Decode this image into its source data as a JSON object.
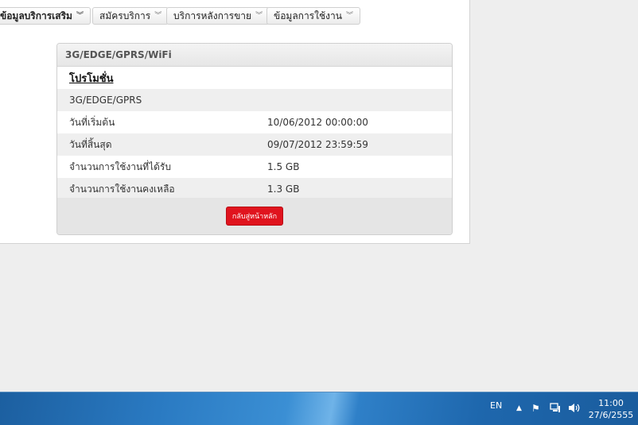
{
  "nav": {
    "items": [
      {
        "label": "ข้อมูลบริการเสริม"
      },
      {
        "label": "สมัครบริการ"
      },
      {
        "label": "บริการหลังการขาย"
      },
      {
        "label": "ข้อมูลการใช้งาน"
      }
    ]
  },
  "card": {
    "title": "3G/EDGE/GPRS/WiFi",
    "promo_label": "โปรโมชั่น",
    "package_name": "3G/EDGE/GPRS",
    "rows": [
      {
        "label": "วันที่เริ่มต้น",
        "value": "10/06/2012 00:00:00"
      },
      {
        "label": "วันที่สิ้นสุด",
        "value": "09/07/2012 23:59:59"
      },
      {
        "label": "จำนวนการใช้งานที่ได้รับ",
        "value": "1.5 GB"
      },
      {
        "label": "จำนวนการใช้งานคงเหลือ",
        "value": "1.3 GB"
      }
    ],
    "back_label": "กลับสู่หน้าหลัก"
  },
  "taskbar": {
    "lang": "EN",
    "time": "11:00",
    "date": "27/6/2555"
  },
  "icons": [
    "chevron-double-down-icon",
    "up-arrow-icon",
    "flag-icon",
    "network-icon",
    "speaker-icon"
  ],
  "colors": {
    "accent": "#e0141e",
    "taskbar": "#1e67ad"
  }
}
